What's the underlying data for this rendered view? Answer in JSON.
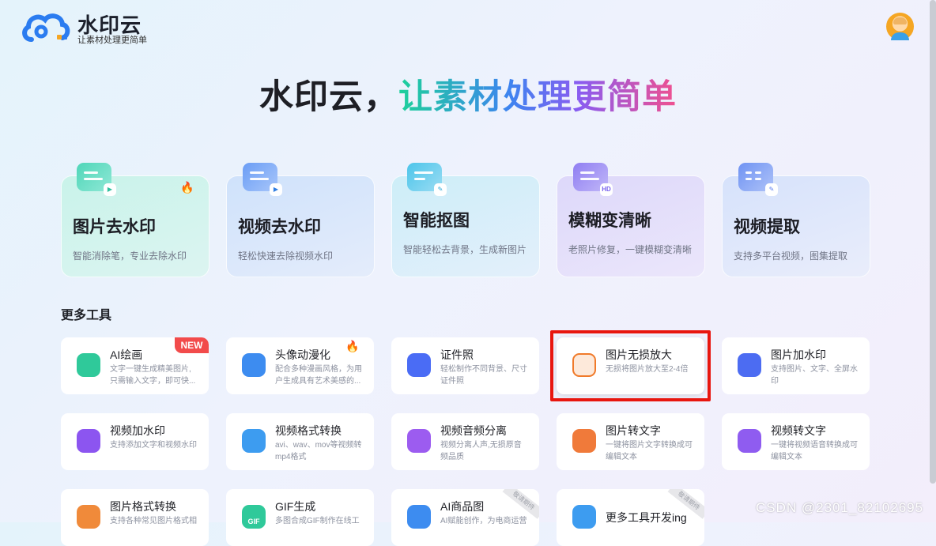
{
  "header": {
    "brand_name": "水印云",
    "brand_slogan": "让素材处理更简单"
  },
  "hero": {
    "title_part1": "水印云，",
    "title_part2": "让素材处理更简单"
  },
  "features": [
    {
      "title": "图片去水印",
      "desc": "智能消除笔，专业去除水印",
      "hot": true
    },
    {
      "title": "视频去水印",
      "desc": "轻松快速去除视频水印"
    },
    {
      "title": "智能抠图",
      "desc": "智能轻松去背景，生成新图片"
    },
    {
      "title": "模糊变清晰",
      "desc": "老照片修复，一键模糊变清晰",
      "sub_icon_text": "HD"
    },
    {
      "title": "视频提取",
      "desc": "支持多平台视频，图集提取"
    }
  ],
  "more_tools_label": "更多工具",
  "tools": [
    {
      "name": "AI绘画",
      "desc": "文字一键生成精美图片,只需输入文字，即可快...",
      "badge": "NEW",
      "color": "#2fc99a"
    },
    {
      "name": "头像动漫化",
      "desc": "配合多种漫画风格，为用户生成具有艺术美感的...",
      "color": "#3d8cf0"
    },
    {
      "name": "证件照",
      "desc": "轻松制作不同背景、尺寸证件照",
      "color": "#4a6cf5"
    },
    {
      "name": "图片无损放大",
      "desc": "无损将图片放大至2-4倍",
      "color": "#f07a2a"
    },
    {
      "name": "图片加水印",
      "desc": "支持图片、文字、全屏水印",
      "color": "#4c6cf2"
    },
    {
      "name": "视频加水印",
      "desc": "支持添加文字和视频水印",
      "color": "#8c55f0"
    },
    {
      "name": "视频格式转换",
      "desc": "avi、wav、mov等视频转mp4格式",
      "color": "#3d9cf0"
    },
    {
      "name": "视频音频分离",
      "desc": "视频分离人声,无损原音频品质",
      "color": "#9c5cf0"
    },
    {
      "name": "图片转文字",
      "desc": "一键将图片文字转换成可编辑文本",
      "color": "#f07a3a"
    },
    {
      "name": "视频转文字",
      "desc": "一键将视频语音转换成可编辑文本",
      "color": "#8f5cf0"
    },
    {
      "name": "图片格式转换",
      "desc": "支持各种常见图片格式相",
      "color": "#f08a3a"
    },
    {
      "name": "GIF生成",
      "desc": "多图合成GIF制作在线工",
      "icon_text": "GIF",
      "color": "#2fc99a"
    },
    {
      "name": "AI商品图",
      "desc": "AI赋能创作，为电商运营",
      "ribbon": "敬请期待",
      "color": "#3d8cf0"
    },
    {
      "name": "更多工具开发ing",
      "desc": "",
      "ribbon": "敬请期待",
      "color": "#3d9cf0"
    }
  ],
  "watermark": "CSDN @2301_82102695"
}
